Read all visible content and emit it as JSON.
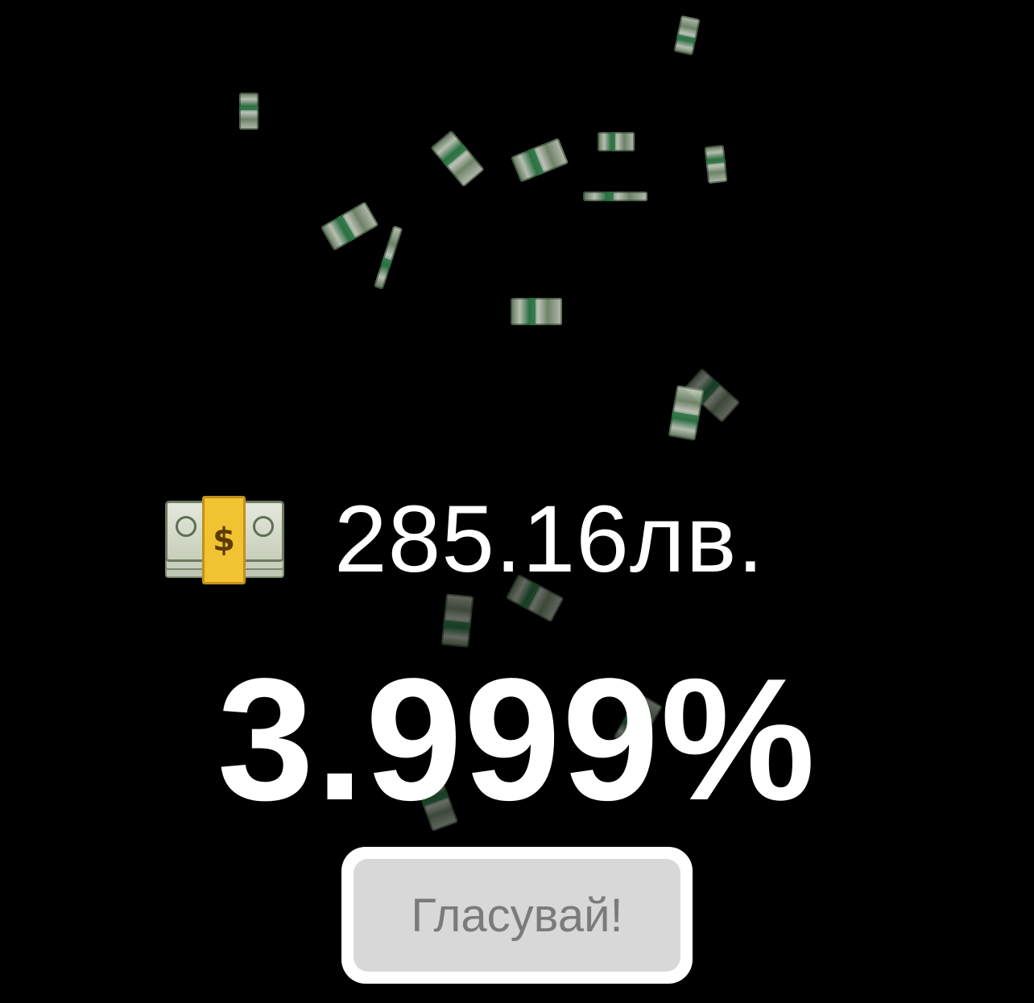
{
  "theme": {
    "background": "#000000",
    "text": "#ffffff",
    "button_face": "#d8d8d8",
    "button_text": "#7b7b7b"
  },
  "decor": {
    "falling_item_icon": "money-bill-icon"
  },
  "balance": {
    "icon": "money-bag-icon",
    "icon_symbol": "$",
    "amount": "285.16лв."
  },
  "percentage": {
    "value": "3.999%"
  },
  "vote_button": {
    "label": "Гласувай!"
  }
}
